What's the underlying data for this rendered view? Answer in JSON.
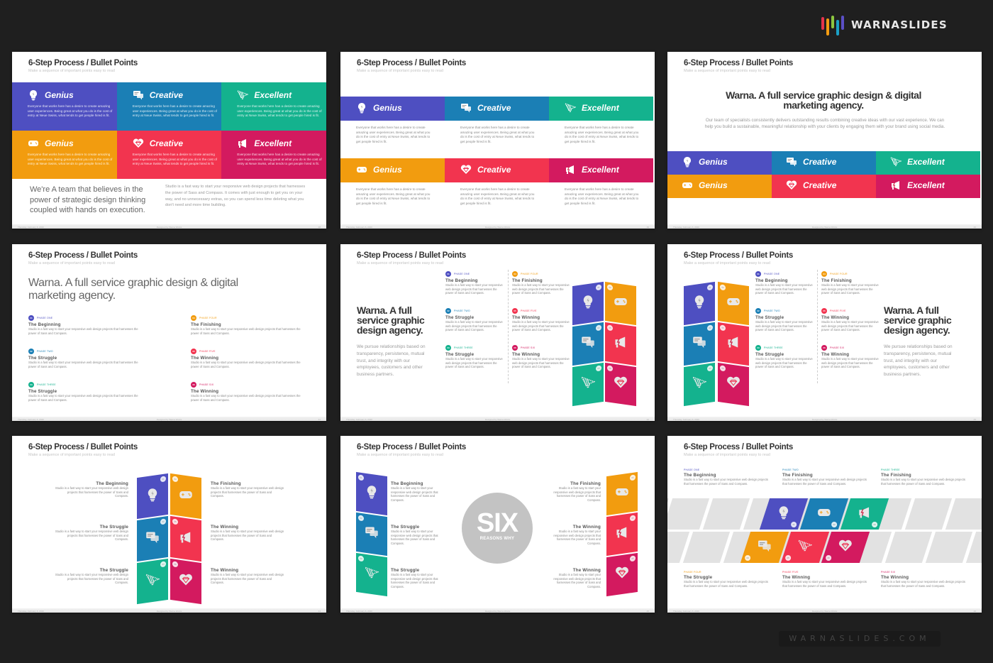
{
  "brand": {
    "name": "WARNASLIDES",
    "bar_colors": [
      "#e5334b",
      "#f39c12",
      "#8cc63f",
      "#1ba1c6",
      "#5b4fc5"
    ],
    "url": "WARNASLIDES.COM"
  },
  "colors": {
    "purple": "#4e4fc1",
    "blue": "#1b7fb5",
    "teal": "#14b28e",
    "orange": "#f29c0f",
    "red": "#f2344f",
    "magenta": "#d31a5f",
    "gray_circle": "#c3c3c3"
  },
  "common": {
    "title": "6-Step Process / Bullet Points",
    "subtitle": "Make a sequence of important points easy to read",
    "footer_date": "Thursday, February 6, 2020",
    "footer_designer": "Designed by Warna Works",
    "tile_text": "Everyone that works here has a desire to create amazing user experiences. Being great at what you do is the cost of entry at Neue Swiss, what tends to get people hired is fit.",
    "phase_text": "Studio is a fast way to start your responsive web design projects that harnesses the power of Sass and Compass."
  },
  "tiles": [
    {
      "label": "Genius",
      "icon": "lightbulb-icon",
      "color": "#4e4fc1"
    },
    {
      "label": "Creative",
      "icon": "chat-bubbles-icon",
      "color": "#1b7fb5"
    },
    {
      "label": "Excellent",
      "icon": "arrow-cursor-icon",
      "color": "#14b28e"
    },
    {
      "label": "Genius",
      "icon": "gamepad-icon",
      "color": "#f29c0f"
    },
    {
      "label": "Creative",
      "icon": "diamond-heart-icon",
      "color": "#f2344f"
    },
    {
      "label": "Excellent",
      "icon": "megaphone-icon",
      "color": "#d31a5f"
    }
  ],
  "phases": [
    {
      "num": "01",
      "label": "Phase One",
      "name": "The Beginning",
      "color": "#4e4fc1"
    },
    {
      "num": "02",
      "label": "Phase Two",
      "name": "The Struggle",
      "color": "#1b7fb5"
    },
    {
      "num": "03",
      "label": "Phase Three",
      "name": "The Struggle",
      "color": "#14b28e"
    },
    {
      "num": "04",
      "label": "Phase Four",
      "name": "The Finishing",
      "color": "#f29c0f"
    },
    {
      "num": "05",
      "label": "Phase Five",
      "name": "The Winning",
      "color": "#f2344f"
    },
    {
      "num": "06",
      "label": "Phase Six",
      "name": "The Winning",
      "color": "#d31a5f"
    }
  ],
  "slides": [
    {
      "number": "38",
      "quote": "We're A team that believes in the power of strategic design thinking coupled with hands on execution.",
      "body": "Studio is a fast way to start your responsive web design projects that harnesses the power of Sass and Compass. It comes with just enough to get you on your way, and no unnecessary extras, so you can spend less time deleting what you don't need and more time building."
    },
    {
      "number": "39"
    },
    {
      "number": "40",
      "headline": "Warna. A full service graphic design & digital marketing agency.",
      "body": "Our team of specialists consistently delivers outstanding results combining creative ideas with our vast experience. We can help you build a sustainable, meaningful relationship with your clients by engaging them with your brand using social media."
    },
    {
      "number": "41",
      "headline": "Warna. A full service graphic design & digital marketing agency."
    },
    {
      "number": "42",
      "headline": "Warna. A full service graphic design agency.",
      "body": "We pursue relationships based on transparency, persistence, mutual trust, and integrity with our employees, customers and other business partners."
    },
    {
      "number": "43",
      "headline": "Warna. A full service graphic design agency.",
      "body": "We pursue relationships based on transparency, persistence, mutual trust, and integrity with our employees, customers and other business partners."
    },
    {
      "number": "44"
    },
    {
      "number": "45",
      "circle_big": "SIX",
      "circle_small": "REASONS WHY"
    },
    {
      "number": "46",
      "timeline_phases": [
        {
          "label": "Phase One",
          "name": "The Beginning",
          "color": "#4e4fc1"
        },
        {
          "label": "Phase Two",
          "name": "The Finishing",
          "color": "#1b7fb5"
        },
        {
          "label": "Phase Three",
          "name": "The Finishing",
          "color": "#14b28e"
        },
        {
          "label": "Phase Four",
          "name": "The Struggle",
          "color": "#f29c0f"
        },
        {
          "label": "Phase Five",
          "name": "The Winning",
          "color": "#f2344f"
        },
        {
          "label": "Phase Six",
          "name": "The Winning",
          "color": "#d31a5f"
        }
      ]
    }
  ]
}
